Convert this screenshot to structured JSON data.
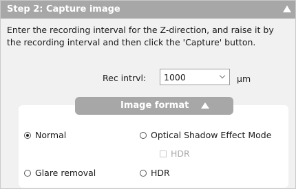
{
  "step": {
    "title": "Step 2: Capture image",
    "instructions": "Enter the recording interval for the Z-direction, and raise it by the recording interval and then click the 'Capture' button."
  },
  "recording_interval": {
    "label": "Rec intrvl:",
    "value": "1000",
    "unit": "μm"
  },
  "image_format": {
    "title": "Image format",
    "options": {
      "normal": {
        "label": "Normal",
        "selected": true
      },
      "optical_shadow": {
        "label": "Optical Shadow Effect Mode",
        "selected": false
      },
      "hdr_sub": {
        "label": "HDR",
        "checked": false,
        "enabled": false
      },
      "glare_removal": {
        "label": "Glare removal",
        "selected": false
      },
      "hdr": {
        "label": "HDR",
        "selected": false
      }
    }
  },
  "colors": {
    "header_bg": "#a7a7a7",
    "panel_bg": "#f1f1f1"
  }
}
